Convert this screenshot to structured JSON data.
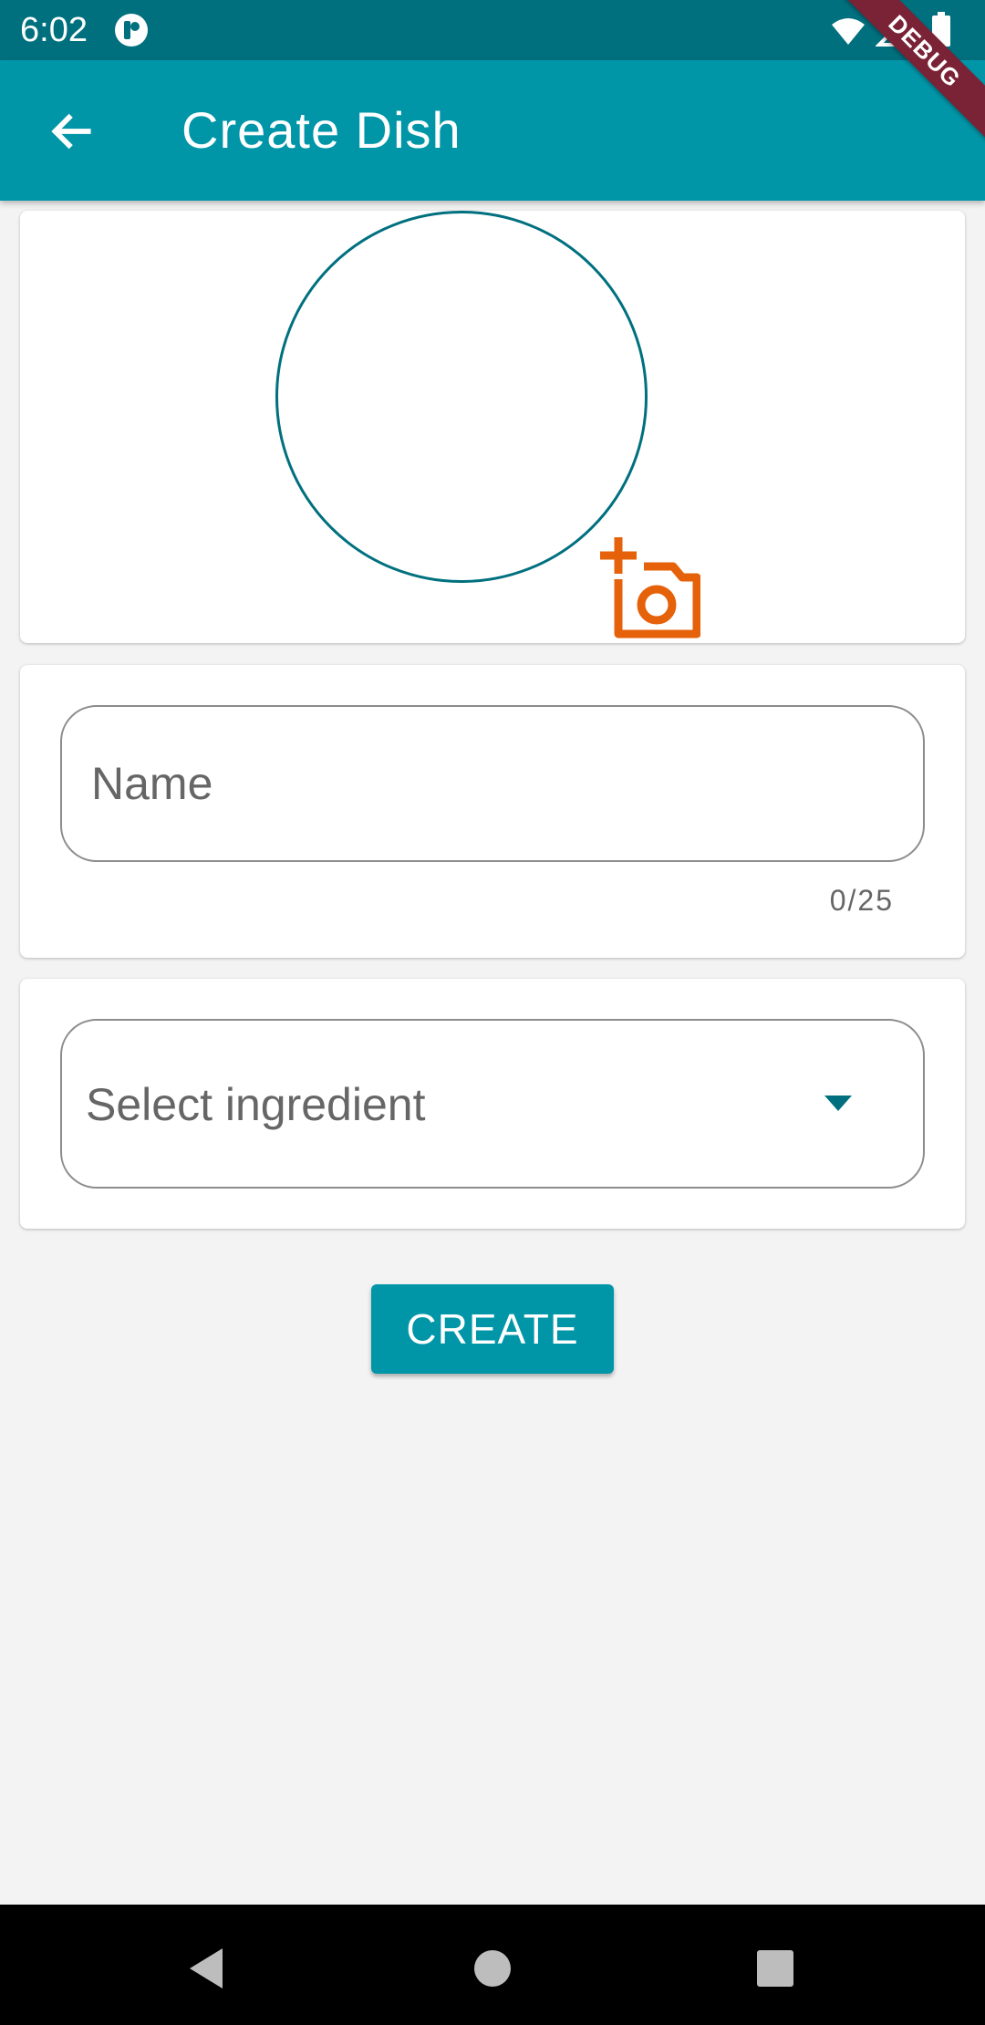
{
  "status_bar": {
    "time": "6:02",
    "icons": [
      "app-notification-icon",
      "wifi-icon",
      "cell-signal-icon",
      "battery-icon"
    ]
  },
  "app_bar": {
    "title": "Create Dish",
    "back_icon": "arrow-back-icon"
  },
  "debug_banner": {
    "label": "DEBUG"
  },
  "photo_section": {
    "add_photo_icon": "add-a-photo-icon"
  },
  "name_field": {
    "placeholder": "Name",
    "counter": "0/25"
  },
  "ingredient_field": {
    "placeholder": "Select ingredient",
    "dropdown_icon": "arrow-drop-down-icon"
  },
  "actions": {
    "create_label": "CREATE"
  },
  "nav_bar": {
    "icons": [
      "nav-back-icon",
      "nav-home-icon",
      "nav-recents-icon"
    ]
  },
  "colors": {
    "primary": "#0096a8",
    "primary_dark": "#00707f",
    "accent": "#e5620a",
    "background": "#f3f3f3",
    "debug_ribbon": "#7a2236"
  }
}
